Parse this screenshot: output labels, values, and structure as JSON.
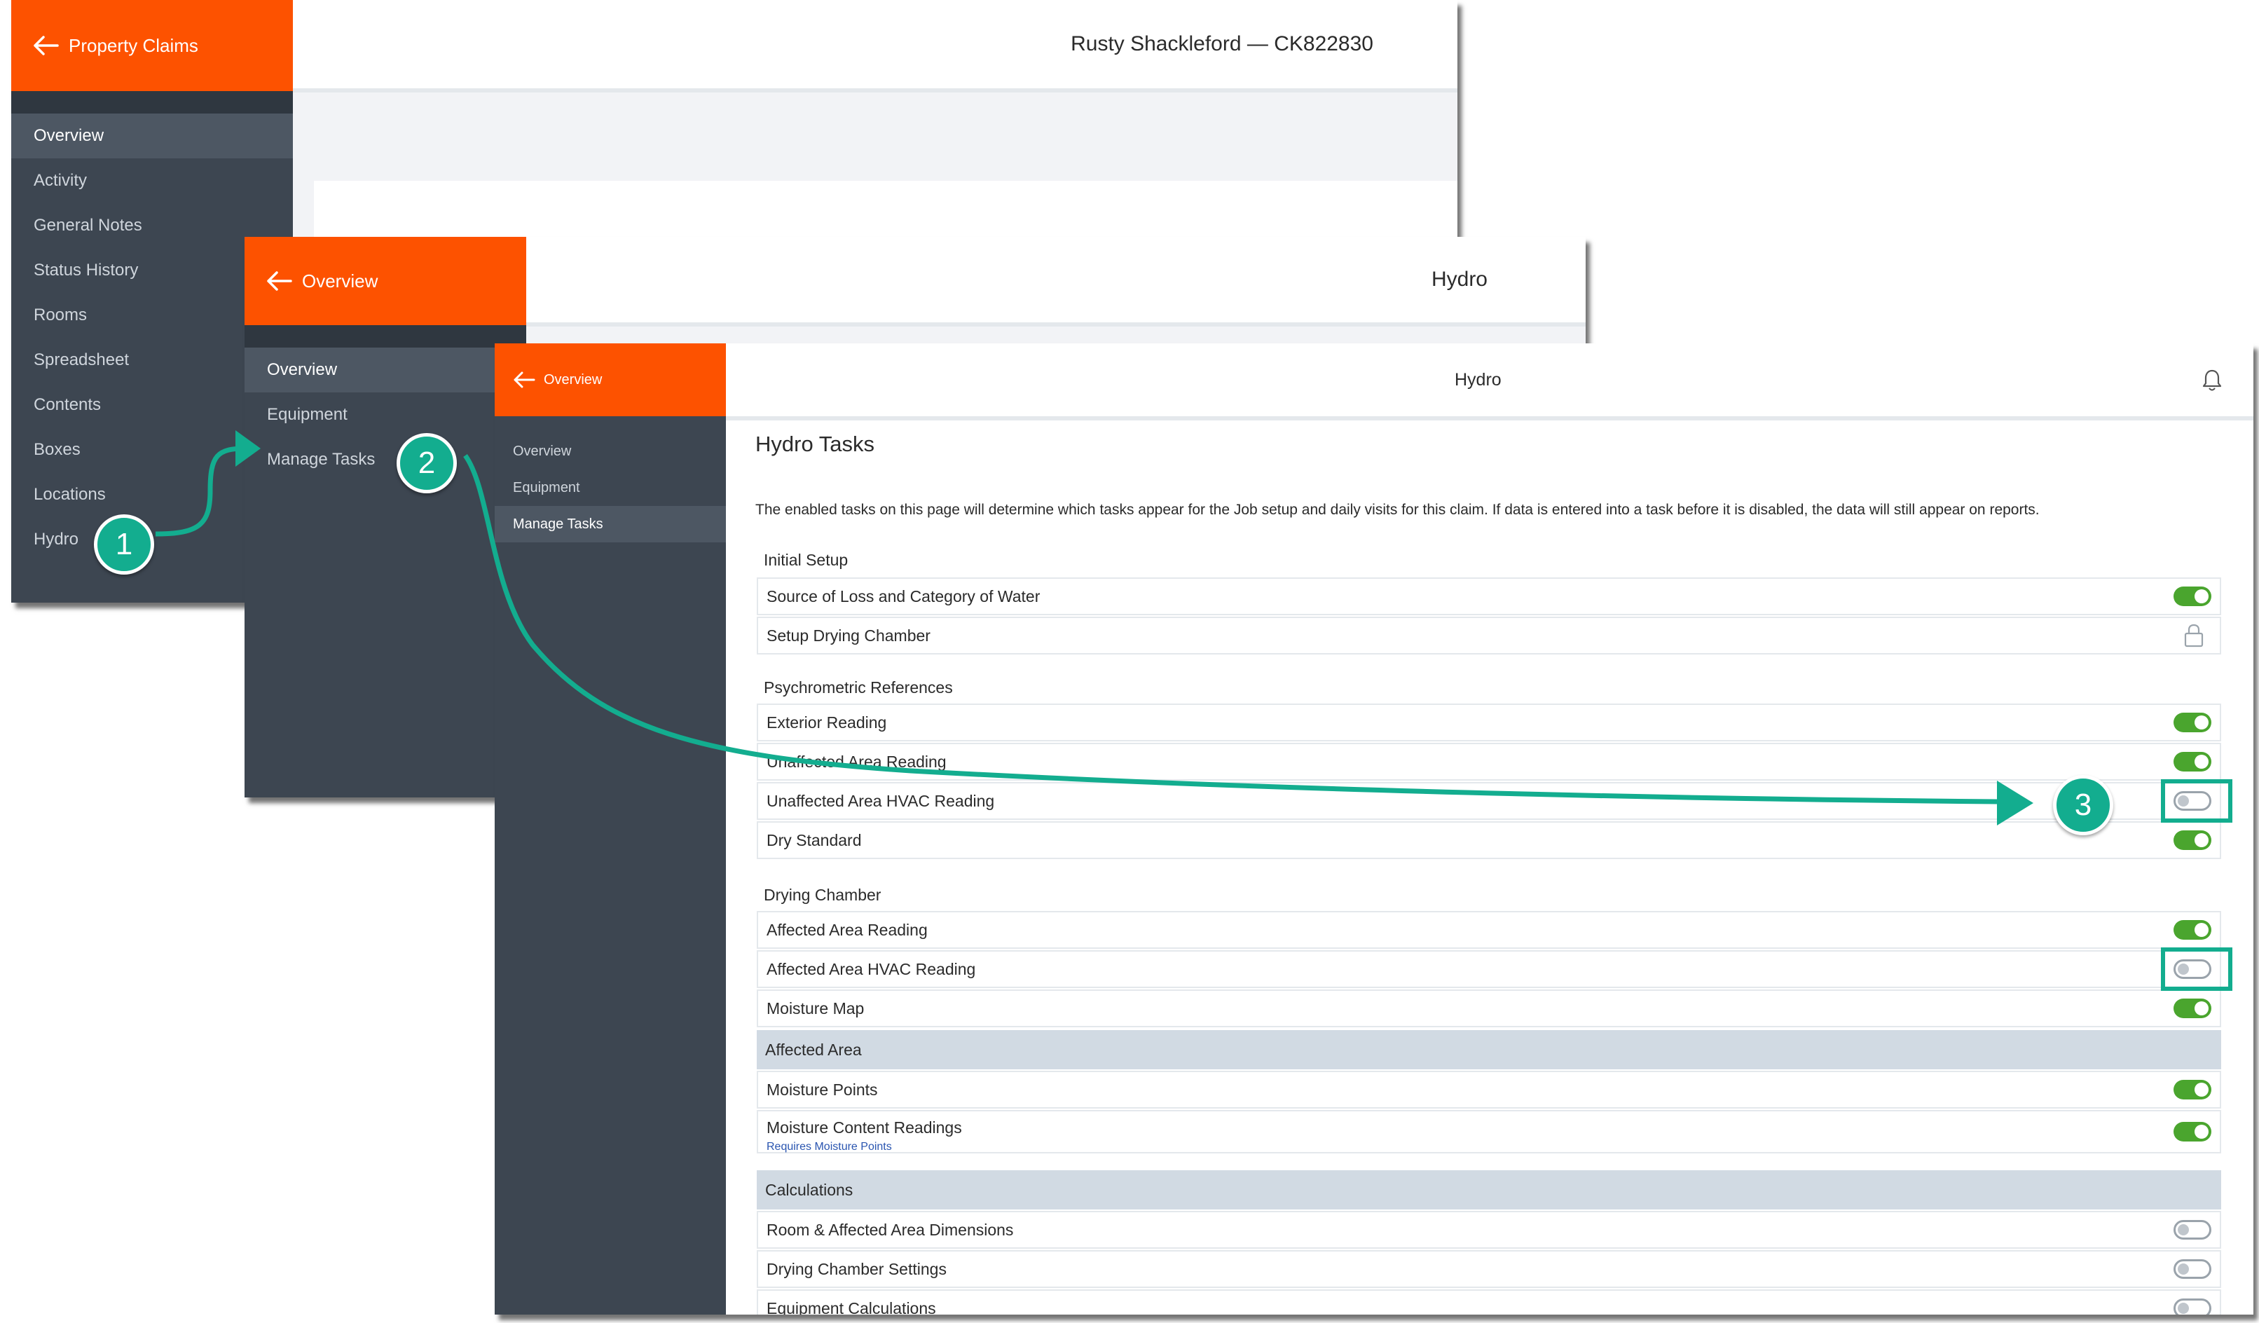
{
  "win1": {
    "brand": "Property Claims",
    "title": "Rusty Shackleford — CK822830",
    "nav": [
      "Overview",
      "Activity",
      "General Notes",
      "Status History",
      "Rooms",
      "Spreadsheet",
      "Contents",
      "Boxes",
      "Locations",
      "Hydro"
    ]
  },
  "win2": {
    "brand": "Overview",
    "title": "Hydro",
    "nav": [
      "Overview",
      "Equipment",
      "Manage Tasks"
    ]
  },
  "win3": {
    "brand": "Overview",
    "title": "Hydro",
    "nav": [
      "Overview",
      "Equipment",
      "Manage Tasks"
    ],
    "heading": "Hydro Tasks",
    "description": "The enabled tasks on this page will determine which tasks appear for the Job setup and daily visits for this claim. If data is entered into a task before it is disabled, the data will still appear on reports.",
    "sections": {
      "initial_setup": "Initial Setup",
      "psychrometric": "Psychrometric References",
      "drying_chamber": "Drying Chamber",
      "affected_area": "Affected Area",
      "calculations": "Calculations"
    },
    "tasks": [
      {
        "label": "Source of Loss and Category of Water",
        "state": "on"
      },
      {
        "label": "Setup Drying Chamber",
        "state": "locked"
      },
      {
        "label": "Exterior Reading",
        "state": "on"
      },
      {
        "label": "Unaffected Area Reading",
        "state": "on"
      },
      {
        "label": "Unaffected Area HVAC Reading",
        "state": "off"
      },
      {
        "label": "Dry Standard",
        "state": "on"
      },
      {
        "label": "Affected Area Reading",
        "state": "on"
      },
      {
        "label": "Affected Area HVAC Reading",
        "state": "off"
      },
      {
        "label": "Moisture Map",
        "state": "on"
      },
      {
        "label": "Moisture Points",
        "state": "on"
      },
      {
        "label": "Moisture Content Readings",
        "state": "on",
        "note": "Requires Moisture Points"
      },
      {
        "label": "Room & Affected Area Dimensions",
        "state": "off"
      },
      {
        "label": "Drying Chamber Settings",
        "state": "off"
      },
      {
        "label": "Equipment Calculations",
        "state": "off"
      }
    ]
  },
  "steps": [
    "1",
    "2",
    "3"
  ],
  "colors": {
    "brand": "#fd5200",
    "sidebar": "#3d4651",
    "accent": "#13ad8f",
    "toggle_on": "#4aa52e"
  }
}
